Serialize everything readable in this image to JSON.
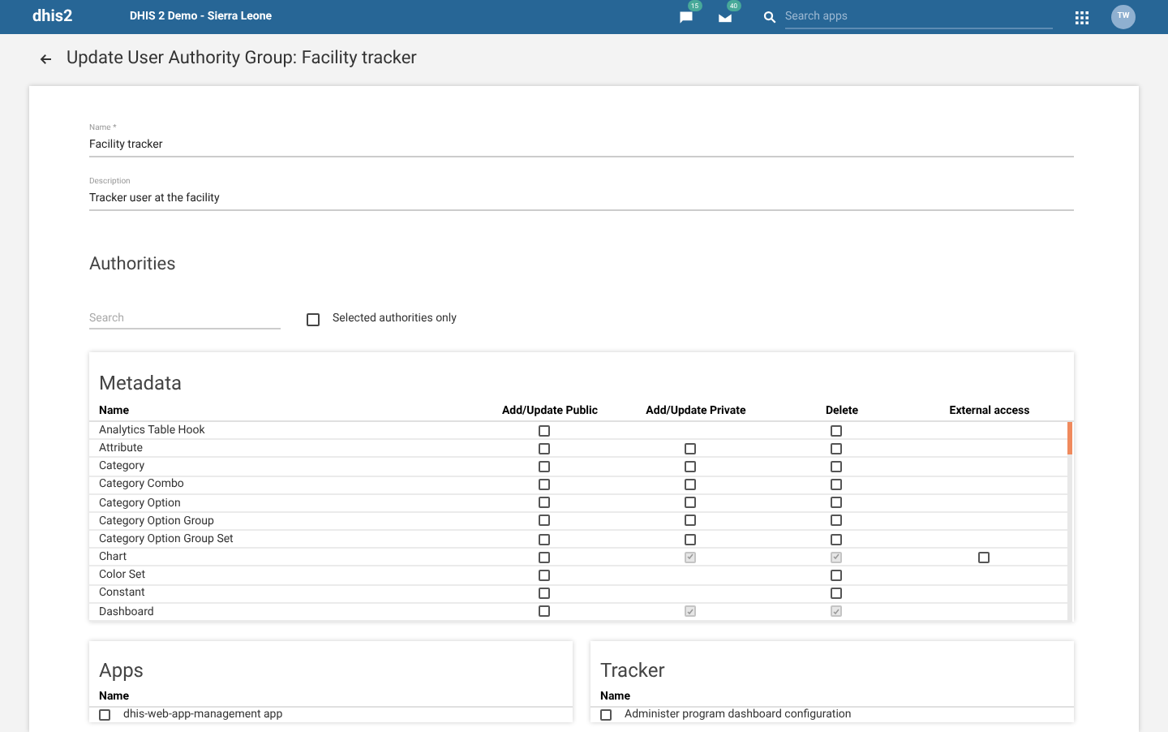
{
  "header": {
    "logo": "dhis2",
    "instance": "DHIS 2 Demo - Sierra Leone",
    "messages_badge": "15",
    "inbox_badge": "40",
    "search": {
      "placeholder": "Search apps"
    },
    "avatar": "TW"
  },
  "page_title": "Update User Authority Group: Facility tracker",
  "form": {
    "name": {
      "label": "Name *",
      "value": "Facility tracker"
    },
    "description": {
      "label": "Description",
      "value": "Tracker user at the facility"
    }
  },
  "authorities": {
    "heading": "Authorities",
    "search": {
      "placeholder": "Search"
    },
    "selected_only": {
      "label": "Selected authorities only",
      "checked": false
    }
  },
  "metadata": {
    "title": "Metadata",
    "columns": [
      "Name",
      "Add/Update Public",
      "Add/Update Private",
      "Delete",
      "External access"
    ],
    "rows": [
      {
        "name": "Analytics Table Hook",
        "cells": [
          {
            "kind": "checkbox",
            "checked": false,
            "disabled": false
          },
          {
            "kind": "blank"
          },
          {
            "kind": "checkbox",
            "checked": false,
            "disabled": false
          },
          {
            "kind": "blank"
          }
        ]
      },
      {
        "name": "Attribute",
        "cells": [
          {
            "kind": "checkbox",
            "checked": false,
            "disabled": false
          },
          {
            "kind": "checkbox",
            "checked": false,
            "disabled": false
          },
          {
            "kind": "checkbox",
            "checked": false,
            "disabled": false
          },
          {
            "kind": "blank"
          }
        ]
      },
      {
        "name": "Category",
        "cells": [
          {
            "kind": "checkbox",
            "checked": false,
            "disabled": false
          },
          {
            "kind": "checkbox",
            "checked": false,
            "disabled": false
          },
          {
            "kind": "checkbox",
            "checked": false,
            "disabled": false
          },
          {
            "kind": "blank"
          }
        ]
      },
      {
        "name": "Category Combo",
        "cells": [
          {
            "kind": "checkbox",
            "checked": false,
            "disabled": false
          },
          {
            "kind": "checkbox",
            "checked": false,
            "disabled": false
          },
          {
            "kind": "checkbox",
            "checked": false,
            "disabled": false
          },
          {
            "kind": "blank"
          }
        ]
      },
      {
        "name": "Category Option",
        "cells": [
          {
            "kind": "checkbox",
            "checked": false,
            "disabled": false
          },
          {
            "kind": "checkbox",
            "checked": false,
            "disabled": false
          },
          {
            "kind": "checkbox",
            "checked": false,
            "disabled": false
          },
          {
            "kind": "blank"
          }
        ]
      },
      {
        "name": "Category Option Group",
        "cells": [
          {
            "kind": "checkbox",
            "checked": false,
            "disabled": false
          },
          {
            "kind": "checkbox",
            "checked": false,
            "disabled": false
          },
          {
            "kind": "checkbox",
            "checked": false,
            "disabled": false
          },
          {
            "kind": "blank"
          }
        ]
      },
      {
        "name": "Category Option Group Set",
        "cells": [
          {
            "kind": "checkbox",
            "checked": false,
            "disabled": false
          },
          {
            "kind": "checkbox",
            "checked": false,
            "disabled": false
          },
          {
            "kind": "checkbox",
            "checked": false,
            "disabled": false
          },
          {
            "kind": "blank"
          }
        ]
      },
      {
        "name": "Chart",
        "cells": [
          {
            "kind": "checkbox",
            "checked": false,
            "disabled": false
          },
          {
            "kind": "checkbox",
            "checked": true,
            "disabled": true
          },
          {
            "kind": "checkbox",
            "checked": true,
            "disabled": true
          },
          {
            "kind": "checkbox",
            "checked": false,
            "disabled": false
          }
        ]
      },
      {
        "name": "Color Set",
        "cells": [
          {
            "kind": "checkbox",
            "checked": false,
            "disabled": false
          },
          {
            "kind": "blank"
          },
          {
            "kind": "checkbox",
            "checked": false,
            "disabled": false
          },
          {
            "kind": "blank"
          }
        ]
      },
      {
        "name": "Constant",
        "cells": [
          {
            "kind": "checkbox",
            "checked": false,
            "disabled": false
          },
          {
            "kind": "blank"
          },
          {
            "kind": "checkbox",
            "checked": false,
            "disabled": false
          },
          {
            "kind": "blank"
          }
        ]
      },
      {
        "name": "Dashboard",
        "cells": [
          {
            "kind": "checkbox",
            "checked": false,
            "disabled": false
          },
          {
            "kind": "checkbox",
            "checked": true,
            "disabled": true
          },
          {
            "kind": "checkbox",
            "checked": true,
            "disabled": true
          },
          {
            "kind": "blank"
          }
        ]
      }
    ]
  },
  "apps": {
    "title": "Apps",
    "column": "Name",
    "rows": [
      {
        "name": "dhis-web-app-management app",
        "checked": false
      }
    ]
  },
  "tracker": {
    "title": "Tracker",
    "column": "Name",
    "rows": [
      {
        "name": "Administer program dashboard configuration",
        "checked": false
      }
    ]
  }
}
